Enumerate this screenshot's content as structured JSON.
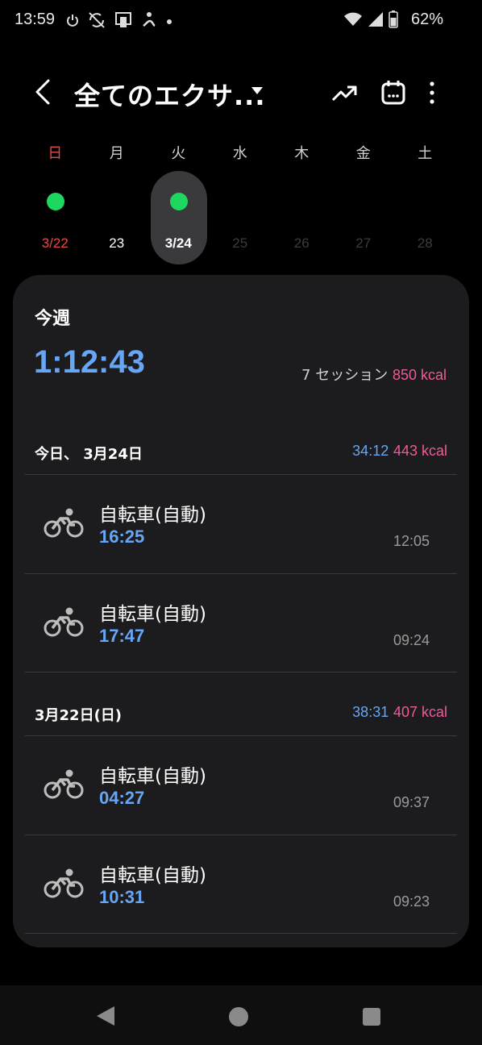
{
  "status_bar": {
    "time": "13:59",
    "battery": "62%",
    "icons": [
      "power-icon",
      "sync-off-icon",
      "nfc-icon",
      "fitness-icon",
      "dot-icon",
      "wifi-icon",
      "signal-icon",
      "battery-icon"
    ]
  },
  "header": {
    "title": "全てのエクサ...",
    "actions": [
      "trend-icon",
      "calendar-icon",
      "more-icon"
    ]
  },
  "week": {
    "weekdays": [
      "日",
      "月",
      "火",
      "水",
      "木",
      "金",
      "土"
    ],
    "days": [
      {
        "label": "3/22",
        "has_activity": true,
        "state": "past"
      },
      {
        "label": "23",
        "has_activity": false,
        "state": "past"
      },
      {
        "label": "3/24",
        "has_activity": true,
        "state": "selected"
      },
      {
        "label": "25",
        "has_activity": false,
        "state": "future"
      },
      {
        "label": "26",
        "has_activity": false,
        "state": "future"
      },
      {
        "label": "27",
        "has_activity": false,
        "state": "future"
      },
      {
        "label": "28",
        "has_activity": false,
        "state": "future"
      }
    ]
  },
  "summary": {
    "label": "今週",
    "total_time": "1:12:43",
    "sessions": "7 セッション",
    "kcal": "850 kcal"
  },
  "groups": [
    {
      "date": "今日、 3月24日",
      "time": "34:12",
      "kcal": "443 kcal",
      "items": [
        {
          "activity": "自転車(自動)",
          "duration": "16:25",
          "clock": "12:05"
        },
        {
          "activity": "自転車(自動)",
          "duration": "17:47",
          "clock": "09:24"
        }
      ]
    },
    {
      "date": "3月22日(日)",
      "time": "38:31",
      "kcal": "407 kcal",
      "items": [
        {
          "activity": "自転車(自動)",
          "duration": "04:27",
          "clock": "09:37"
        },
        {
          "activity": "自転車(自動)",
          "duration": "10:31",
          "clock": "09:23"
        }
      ]
    }
  ],
  "colors": {
    "accent_blue": "#66a6f5",
    "kcal_pink": "#ee5a9a",
    "activity_green": "#1ed760",
    "sunday_red": "#e8484a",
    "card_bg": "#1c1c1e"
  }
}
